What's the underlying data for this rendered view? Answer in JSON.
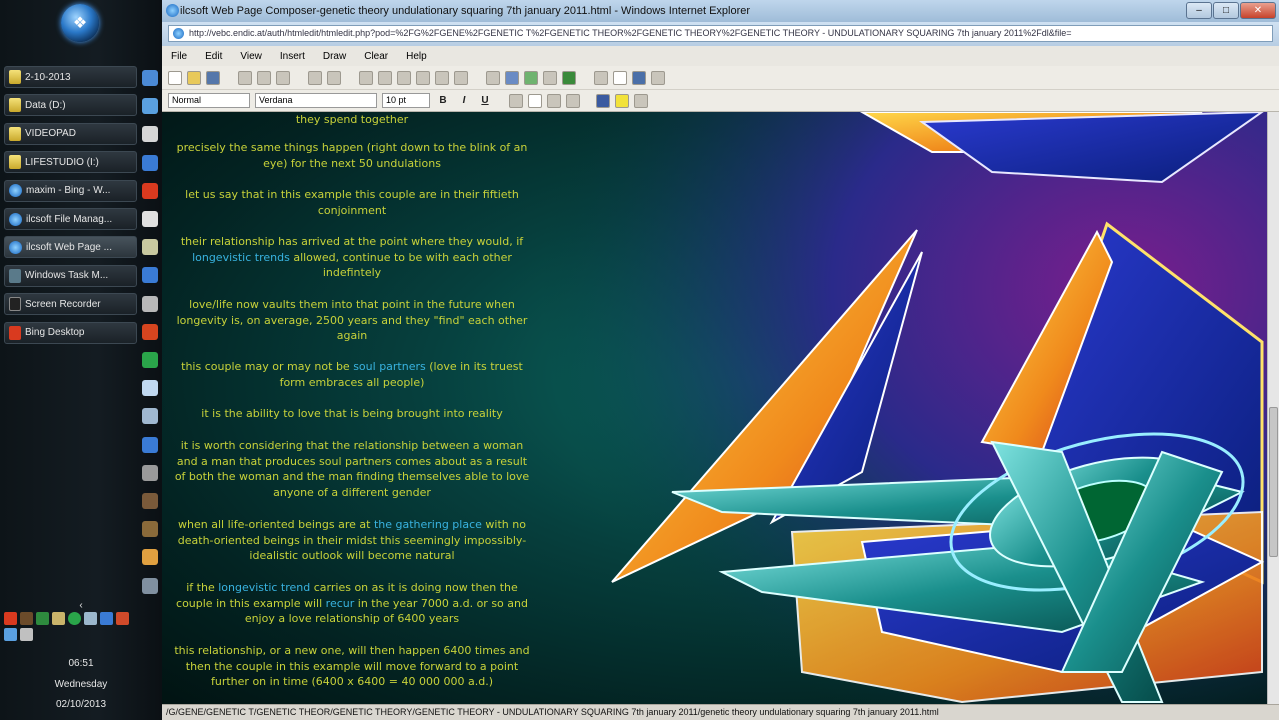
{
  "taskbar": {
    "buttons": [
      {
        "label": "2-10-2013",
        "icon": "folder-icon"
      },
      {
        "label": "Data (D:)",
        "icon": "folder-icon"
      },
      {
        "label": "VIDEOPAD",
        "icon": "folder-icon"
      },
      {
        "label": "LIFESTUDIO (I:)",
        "icon": "folder-icon"
      },
      {
        "label": "maxim - Bing - W...",
        "icon": "ie-icon"
      },
      {
        "label": "ilcsoft File Manag...",
        "icon": "ie-icon"
      },
      {
        "label": "ilcsoft Web Page ...",
        "icon": "ie-icon"
      },
      {
        "label": "Windows Task M...",
        "icon": "task-manager-icon"
      },
      {
        "label": "Screen Recorder",
        "icon": "recorder-icon"
      },
      {
        "label": "Bing Desktop",
        "icon": "bing-icon"
      }
    ],
    "tray_arrow": "‹",
    "clock": {
      "time": "06:51",
      "day": "Wednesday",
      "date": "02/10/2013"
    }
  },
  "window": {
    "title": "ilcsoft Web Page Composer-genetic theory undulationary squaring 7th january 2011.html - Windows Internet Explorer",
    "address": "http://vebc.endic.at/auth/htmledit/htmledit.php?pod=%2FG%2FGENE%2FGENETIC T%2FGENETIC THEOR%2FGENETIC THEORY%2FGENETIC THEORY - UNDULATIONARY SQUARING 7th january 2011%2Fdl&file=",
    "controls": {
      "minimize": "–",
      "maximize": "□",
      "close": "✕"
    }
  },
  "menu": [
    "File",
    "Edit",
    "View",
    "Insert",
    "Draw",
    "Clear",
    "Help"
  ],
  "format_bar": {
    "style": "Normal",
    "font": "Verdana",
    "size": "10 pt",
    "bold": "B",
    "italic": "I",
    "underline": "U"
  },
  "document": {
    "fragment_top": "they spend together",
    "paragraphs": [
      {
        "parts": [
          {
            "t": "precisely the same things happen (right down to the blink of an eye) for the next 50 undulations"
          }
        ]
      },
      {
        "parts": [
          {
            "t": "let us say that in this example this couple are in their fiftieth conjoinment"
          }
        ]
      },
      {
        "parts": [
          {
            "t": "their relationship has arrived at the point where they would, if "
          },
          {
            "t": "longevistic trends",
            "link": true
          },
          {
            "t": " allowed, continue to be with each other indefintely"
          }
        ]
      },
      {
        "parts": [
          {
            "t": "love/life now vaults them into that point in the future when longevity is, on average, 2500 years and they \"find\" each other again"
          }
        ]
      },
      {
        "parts": [
          {
            "t": "this couple may or may not be "
          },
          {
            "t": "soul partners",
            "link": true
          },
          {
            "t": " (love in its truest form embraces all people)"
          }
        ]
      },
      {
        "parts": [
          {
            "t": "it is the ability to love that is being brought into reality"
          }
        ]
      },
      {
        "parts": [
          {
            "t": "it is worth considering that the relationship between a woman and a man that produces soul partners comes about as a result of both the woman and the man finding themselves able to love anyone of a different gender"
          }
        ]
      },
      {
        "parts": [
          {
            "t": "when all life-oriented beings are at "
          },
          {
            "t": "the gathering place",
            "link": true
          },
          {
            "t": " with no death-oriented beings in their midst this seemingly impossibly-idealistic outlook will become natural"
          }
        ]
      },
      {
        "parts": [
          {
            "t": "if the "
          },
          {
            "t": "longevistic trend",
            "link": true
          },
          {
            "t": " carries on as it is doing now then the couple in this example will "
          },
          {
            "t": "recur",
            "link": true
          },
          {
            "t": " in the year 7000 a.d. or so and enjoy a love relationship of 6400 years"
          }
        ]
      },
      {
        "parts": [
          {
            "t": "this relationship, or a new one, will then happen 6400 times and then the couple in this example will move forward to a point further on in time (6400 x 6400 = 40 000 000 a.d.)"
          }
        ]
      }
    ]
  },
  "status_bar": "/G/GENE/GENETIC T/GENETIC THEOR/GENETIC THEORY/GENETIC THEORY - UNDULATIONARY SQUARING 7th january 2011/genetic theory undulationary squaring 7th january 2011.html",
  "colors": {
    "text": "#c8d23a",
    "link": "#39b3e0",
    "background_teal": "#06403e"
  }
}
